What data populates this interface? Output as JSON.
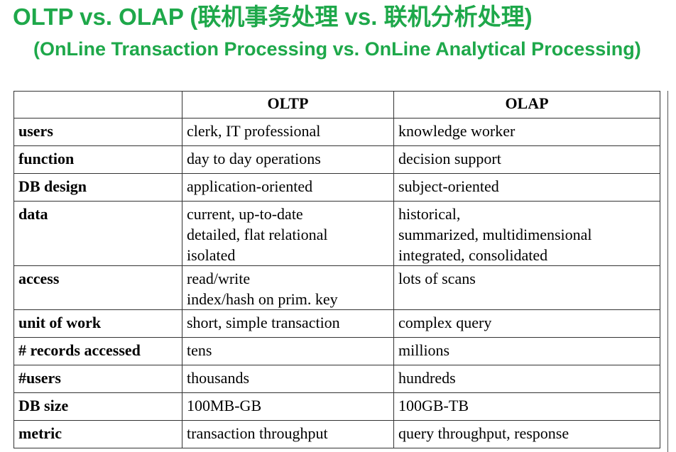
{
  "slide": {
    "title": "OLTP vs. OLAP (联机事务处理 vs. 联机分析处理)",
    "subtitle": "(OnLine Transaction Processing vs. OnLine Analytical Processing)"
  },
  "table": {
    "headers": [
      "",
      "OLTP",
      "OLAP"
    ],
    "rows": [
      {
        "label": "users",
        "oltp": [
          "clerk, IT professional"
        ],
        "olap": [
          "knowledge worker"
        ]
      },
      {
        "label": "function",
        "oltp": [
          "day to day operations"
        ],
        "olap": [
          "decision support"
        ]
      },
      {
        "label": "DB design",
        "oltp": [
          "application-oriented"
        ],
        "olap": [
          "subject-oriented"
        ]
      },
      {
        "label": "data",
        "oltp": [
          "current, up-to-date",
          "detailed, flat relational",
          "isolated"
        ],
        "olap": [
          "historical,",
          "summarized, multidimensional",
          "integrated, consolidated"
        ]
      },
      {
        "label": "access",
        "oltp": [
          "read/write",
          "index/hash on prim. key"
        ],
        "olap": [
          "lots of scans"
        ]
      },
      {
        "label": "unit of work",
        "oltp": [
          "short, simple transaction"
        ],
        "olap": [
          "complex query"
        ]
      },
      {
        "label": "# records accessed",
        "oltp": [
          "tens"
        ],
        "olap": [
          "millions"
        ]
      },
      {
        "label": "#users",
        "oltp": [
          "thousands"
        ],
        "olap": [
          "hundreds"
        ]
      },
      {
        "label": "DB size",
        "oltp": [
          "100MB-GB"
        ],
        "olap": [
          "100GB-TB"
        ]
      },
      {
        "label": "metric",
        "oltp": [
          "transaction throughput"
        ],
        "olap": [
          "query throughput, response"
        ]
      }
    ]
  }
}
